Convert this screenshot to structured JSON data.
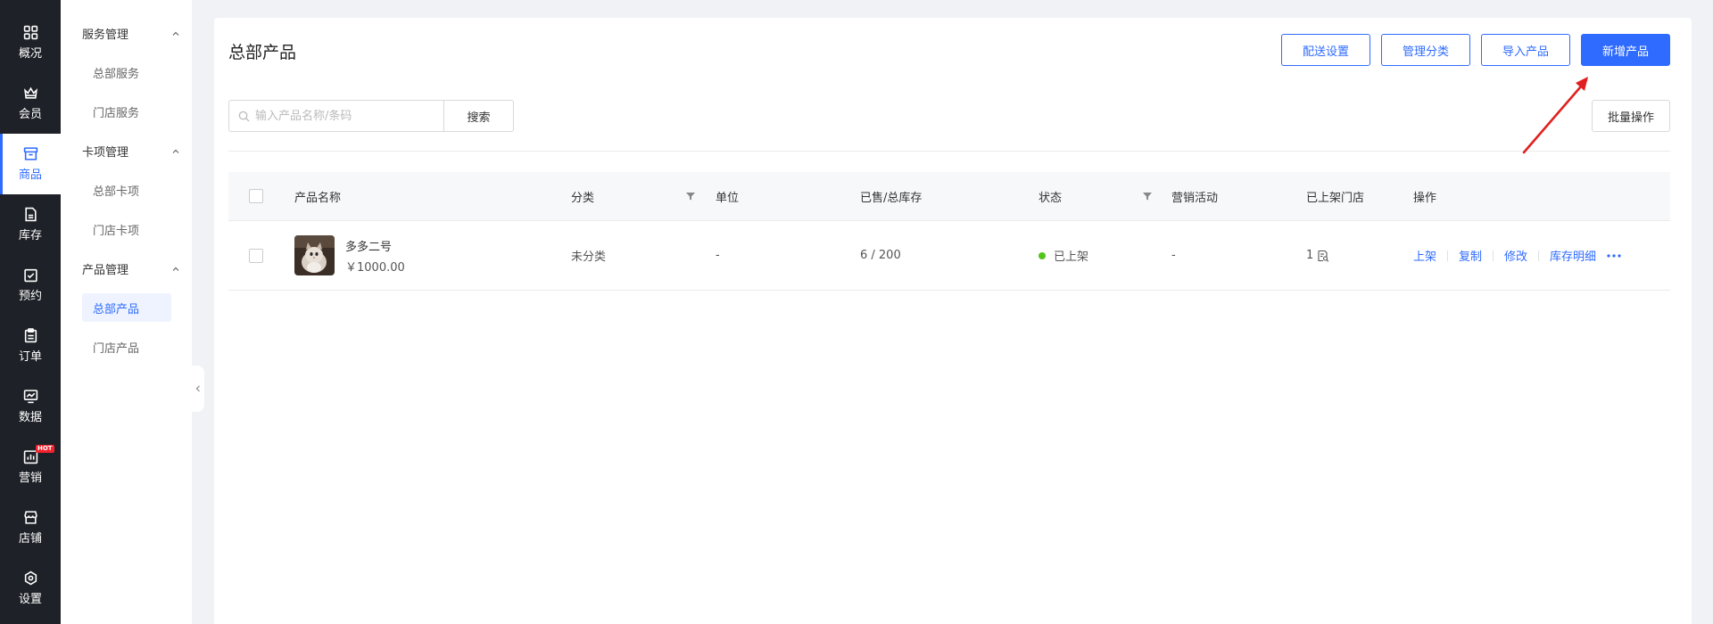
{
  "nav": {
    "items": [
      {
        "label": "概况",
        "icon": "grid-icon"
      },
      {
        "label": "会员",
        "icon": "crown-icon"
      },
      {
        "label": "商品",
        "icon": "store-box-icon",
        "active": true
      },
      {
        "label": "库存",
        "icon": "inventory-icon"
      },
      {
        "label": "预约",
        "icon": "calendar-check-icon"
      },
      {
        "label": "订单",
        "icon": "clipboard-icon"
      },
      {
        "label": "数据",
        "icon": "chart-monitor-icon"
      },
      {
        "label": "营销",
        "icon": "bar-chart-icon",
        "badge": "HOT"
      },
      {
        "label": "店铺",
        "icon": "shop-icon"
      },
      {
        "label": "设置",
        "icon": "settings-icon"
      }
    ]
  },
  "subnav": {
    "groups": [
      {
        "title": "服务管理",
        "items": [
          "总部服务",
          "门店服务"
        ]
      },
      {
        "title": "卡项管理",
        "items": [
          "总部卡项",
          "门店卡项"
        ]
      },
      {
        "title": "产品管理",
        "items": [
          "总部产品",
          "门店产品"
        ]
      }
    ],
    "active_item": "总部产品"
  },
  "page": {
    "title": "总部产品",
    "buttons": {
      "delivery_settings": "配送设置",
      "manage_category": "管理分类",
      "import_product": "导入产品",
      "add_product": "新增产品",
      "batch_ops": "批量操作"
    },
    "search": {
      "placeholder": "输入产品名称/条码",
      "button": "搜索"
    }
  },
  "table": {
    "columns": {
      "name": "产品名称",
      "category": "分类",
      "unit": "单位",
      "sold_stock": "已售/总库存",
      "status": "状态",
      "marketing": "营销活动",
      "stores": "已上架门店",
      "actions": "操作"
    },
    "rows": [
      {
        "name": "多多二号",
        "price": "￥1000.00",
        "category": "未分类",
        "unit": "-",
        "sold_stock": "6 / 200",
        "status": "已上架",
        "marketing": "-",
        "stores": "1",
        "actions": [
          "上架",
          "复制",
          "修改",
          "库存明细"
        ]
      }
    ]
  },
  "colors": {
    "accent": "#2f6bff",
    "nav_bg": "#1e2127",
    "status_on": "#52c41a",
    "annotation": "#e02020"
  }
}
